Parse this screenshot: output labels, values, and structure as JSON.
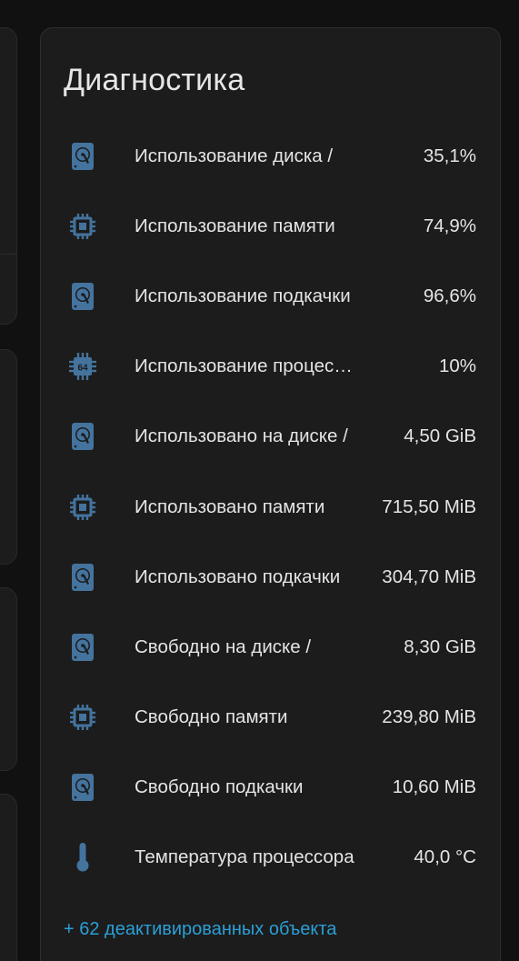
{
  "colors": {
    "icon": "#44739e",
    "text": "#e4e4e4",
    "link": "#2a9fd6",
    "card_bg": "#1c1c1c",
    "page_bg": "#111111"
  },
  "card": {
    "title": "Диагностика",
    "rows": [
      {
        "icon": "harddisk-icon",
        "label": "Использование диска /",
        "value": "35,1%"
      },
      {
        "icon": "memory-icon",
        "label": "Использование памяти",
        "value": "74,9%"
      },
      {
        "icon": "harddisk-icon",
        "label": "Использование подкачки",
        "value": "96,6%"
      },
      {
        "icon": "cpu-64-icon",
        "label": "Использование процессора",
        "value": "10%"
      },
      {
        "icon": "harddisk-icon",
        "label": "Использовано на диске /",
        "value": "4,50 GiB"
      },
      {
        "icon": "memory-icon",
        "label": "Использовано памяти",
        "value": "715,50 MiB"
      },
      {
        "icon": "harddisk-icon",
        "label": "Использовано подкачки",
        "value": "304,70 MiB"
      },
      {
        "icon": "harddisk-icon",
        "label": "Свободно на диске /",
        "value": "8,30 GiB"
      },
      {
        "icon": "memory-icon",
        "label": "Свободно памяти",
        "value": "239,80 MiB"
      },
      {
        "icon": "harddisk-icon",
        "label": "Свободно подкачки",
        "value": "10,60 MiB"
      },
      {
        "icon": "thermometer-icon",
        "label": "Температура процессора",
        "value": "40,0 °C"
      }
    ],
    "more_link": "+ 62 деактивированных объекта"
  }
}
